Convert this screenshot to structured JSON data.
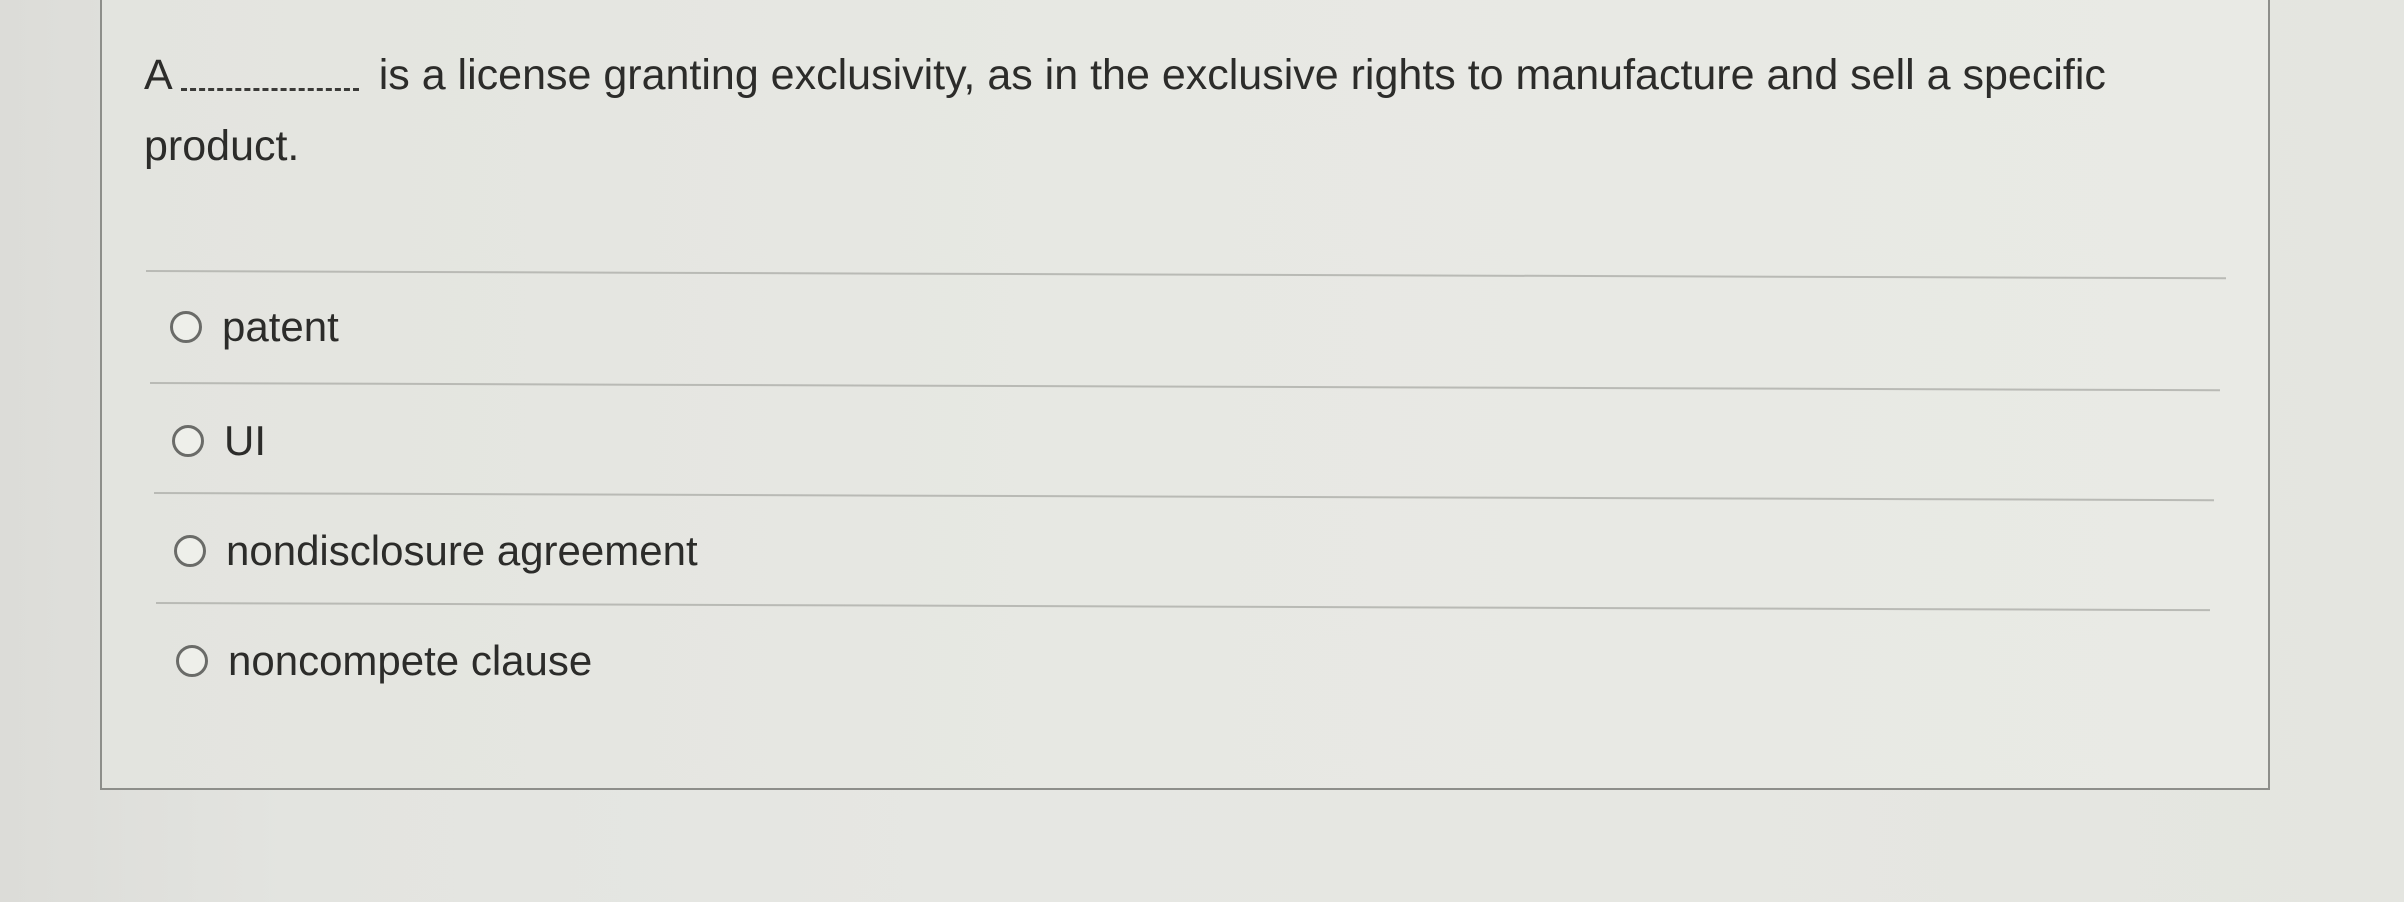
{
  "question": {
    "prefix": "A",
    "text": "is a license granting exclusivity, as in the exclusive rights to manufacture and sell a specific product."
  },
  "options": [
    {
      "label": "patent",
      "selected": false
    },
    {
      "label": "UI",
      "selected": false
    },
    {
      "label": "nondisclosure agreement",
      "selected": false
    },
    {
      "label": "noncompete clause",
      "selected": false
    }
  ]
}
